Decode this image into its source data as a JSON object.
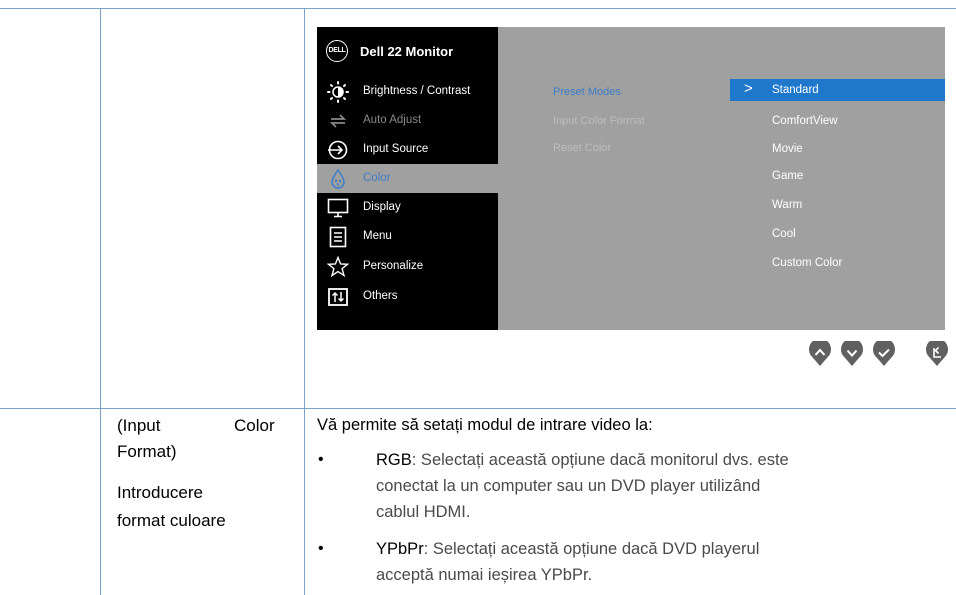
{
  "osd": {
    "title": "Dell 22 Monitor",
    "logo_text": "DELL",
    "menu": [
      {
        "label": "Brightness / Contrast",
        "icon": "brightness-icon",
        "state": "normal"
      },
      {
        "label": "Auto Adjust",
        "icon": "auto-adjust-icon",
        "state": "dim"
      },
      {
        "label": "Input Source",
        "icon": "input-source-icon",
        "state": "normal"
      },
      {
        "label": "Color",
        "icon": "color-icon",
        "state": "active"
      },
      {
        "label": "Display",
        "icon": "display-icon",
        "state": "normal"
      },
      {
        "label": "Menu",
        "icon": "menu-icon",
        "state": "normal"
      },
      {
        "label": "Personalize",
        "icon": "star-icon",
        "state": "normal"
      },
      {
        "label": "Others",
        "icon": "others-icon",
        "state": "normal"
      }
    ],
    "submenu": [
      "Preset Modes",
      "Input Color Format",
      "Reset Color"
    ],
    "options": [
      "Standard",
      "ComfortView",
      "Movie",
      "Game",
      "Warm",
      "Cool",
      "Custom Color"
    ],
    "selected_option": "Standard",
    "colors": {
      "accent": "#1f78cc",
      "active_text": "#3d7ec8",
      "panel_bg": "#a0a0a0"
    }
  },
  "nav_buttons": [
    "up-arrow-icon",
    "down-arrow-icon",
    "check-icon",
    "back-icon"
  ],
  "row2": {
    "left_line1a": "(Input",
    "left_line1b": "Color",
    "left_line2": "Format)",
    "left_line3": "Introducere",
    "left_line4": "format culoare",
    "intro": "Vă permite să setați modul de intrare video la:",
    "bullet_symbol": "•",
    "rgb_term": "RGB",
    "rgb_lines": [
      ": Selectați această opțiune dacă monitorul dvs. este",
      "conectat la un computer sau un DVD player utilizând",
      "cablul HDMI."
    ],
    "ypbpr_term": "YPbPr",
    "ypbpr_lines": [
      ": Selectați această opțiune dacă DVD playerul",
      "acceptă numai ieșirea YPbPr."
    ]
  }
}
